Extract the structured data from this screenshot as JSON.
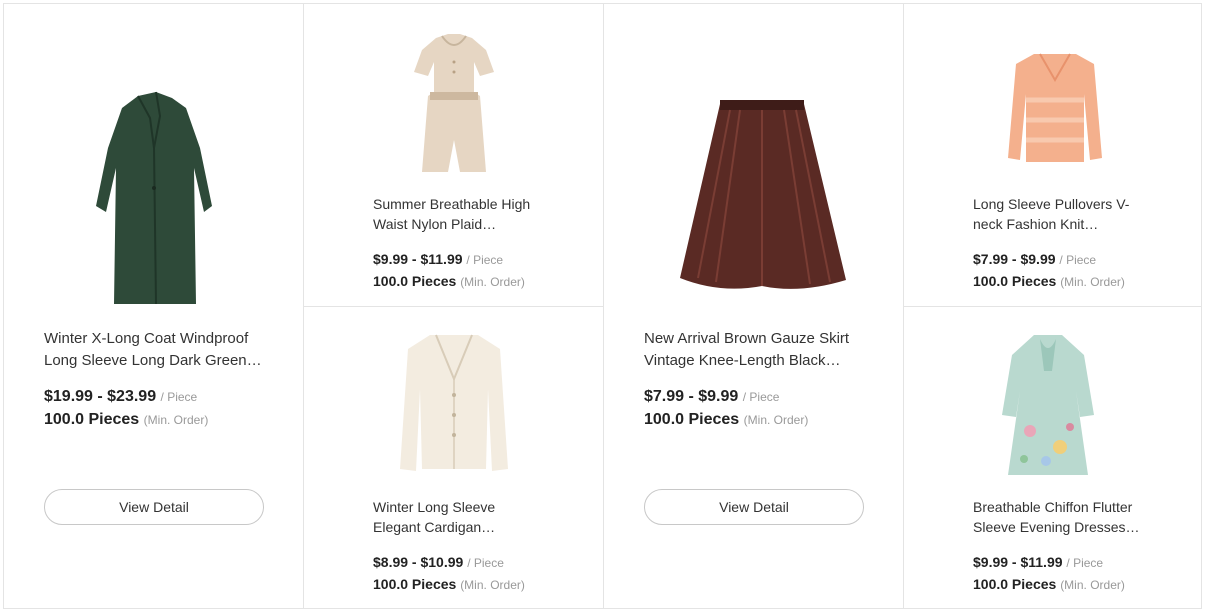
{
  "products": [
    {
      "title": "Winter X-Long Coat Windproof\nLong Sleeve Long Dark Green…",
      "price": "$19.99 - $23.99",
      "unit": "/ Piece",
      "moq": "100.0 Pieces",
      "moq_note": "(Min. Order)",
      "button": "View Detail",
      "image_icon": "green-long-coat-image"
    },
    {
      "title": "Summer Breathable High\nWaist Nylon Plaid…",
      "price": "$9.99 - $11.99",
      "unit": "/ Piece",
      "moq": "100.0 Pieces",
      "moq_note": "(Min. Order)",
      "image_icon": "beige-romper-image"
    },
    {
      "title": "Winter Long Sleeve\nElegant Cardigan…",
      "price": "$8.99 - $10.99",
      "unit": "/ Piece",
      "moq": "100.0 Pieces",
      "moq_note": "(Min. Order)",
      "image_icon": "cream-cardigan-image"
    },
    {
      "title": "New Arrival Brown Gauze Skirt\nVintage Knee-Length Black…",
      "price": "$7.99 - $9.99",
      "unit": "/ Piece",
      "moq": "100.0 Pieces",
      "moq_note": "(Min. Order)",
      "button": "View Detail",
      "image_icon": "brown-tulle-skirt-image"
    },
    {
      "title": "Long Sleeve Pullovers V-\nneck Fashion Knit…",
      "price": "$7.99 - $9.99",
      "unit": "/ Piece",
      "moq": "100.0 Pieces",
      "moq_note": "(Min. Order)",
      "image_icon": "peach-sweater-image"
    },
    {
      "title": "Breathable Chiffon Flutter\nSleeve Evening Dresses…",
      "price": "$9.99 - $11.99",
      "unit": "/ Piece",
      "moq": "100.0 Pieces",
      "moq_note": "(Min. Order)",
      "image_icon": "floral-dress-image"
    }
  ]
}
